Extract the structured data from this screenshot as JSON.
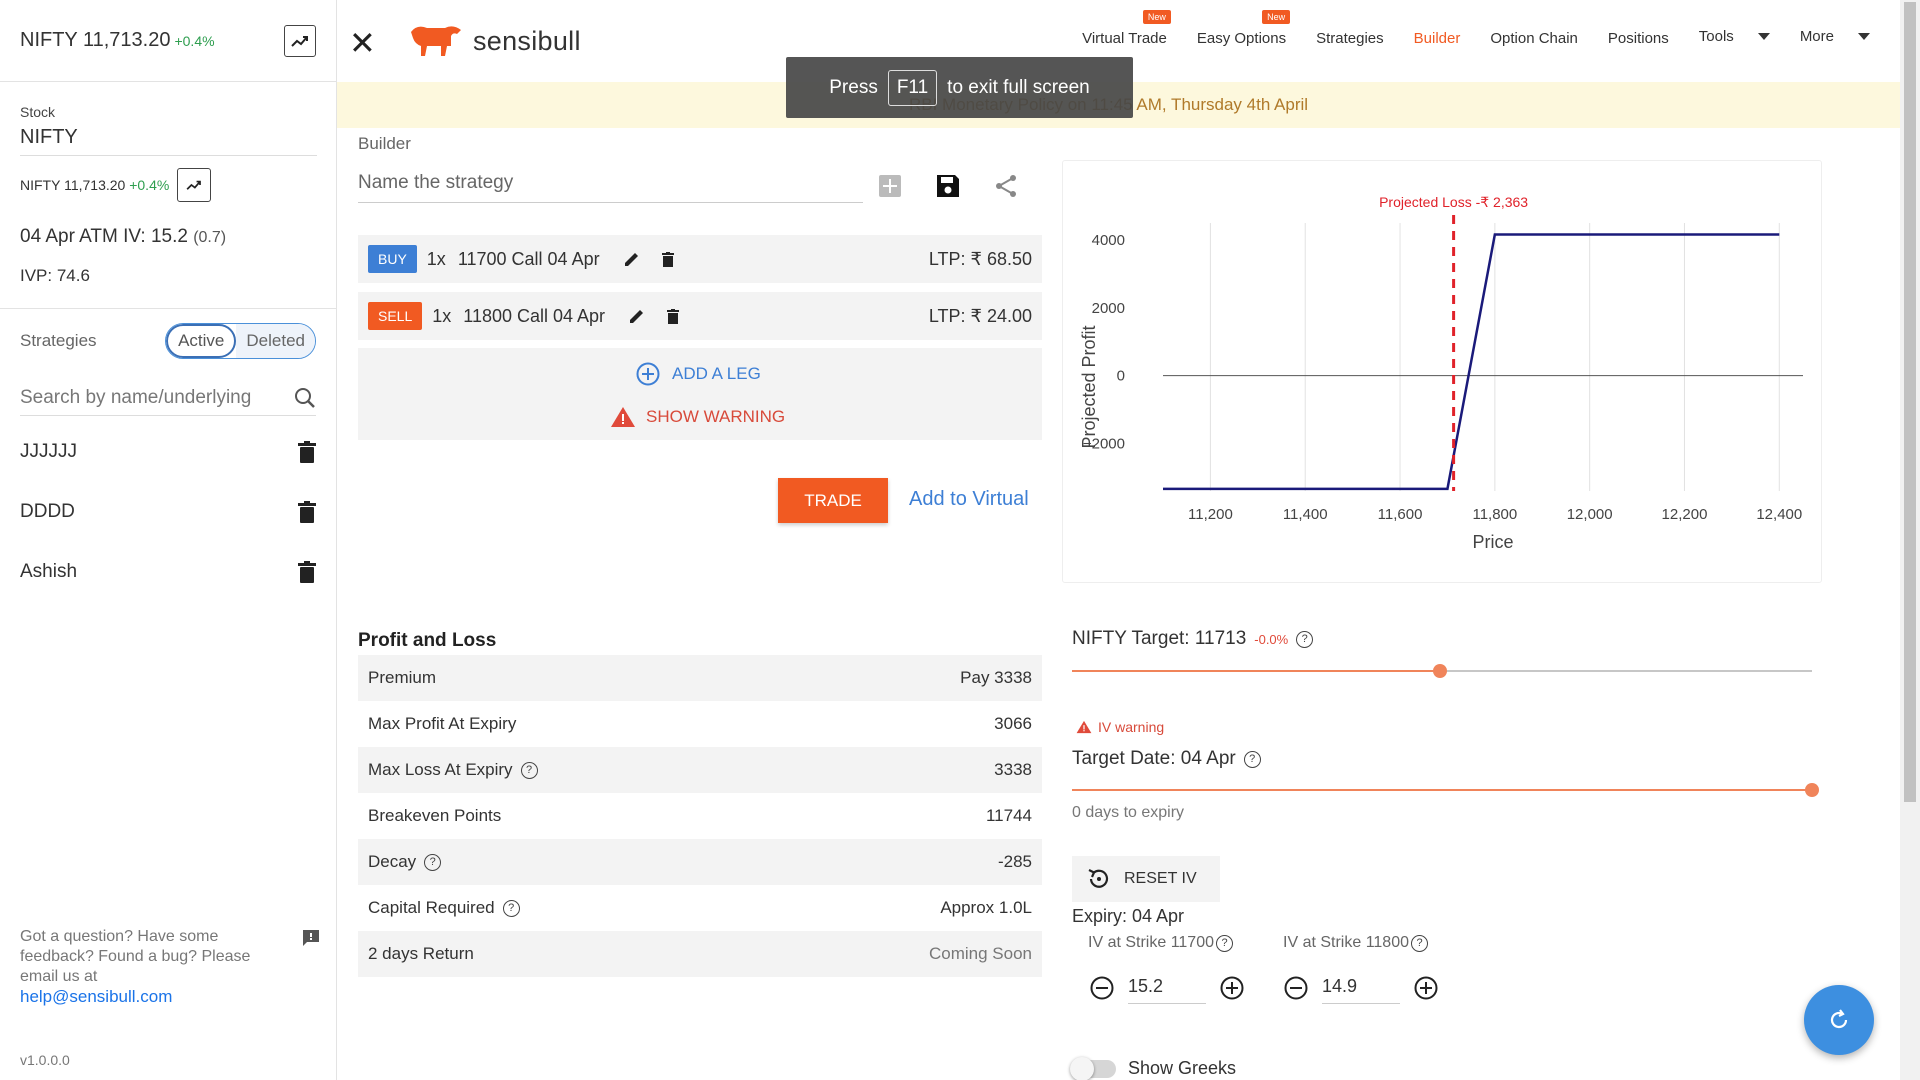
{
  "sidebar": {
    "ticker": "NIFTY 11,713.20",
    "ticker_change": "+0.4%",
    "stock_label": "Stock",
    "stock_value": "NIFTY",
    "ticker_small": "NIFTY 11,713.20",
    "ticker_small_change": "+0.4%",
    "atm_iv": "04 Apr ATM IV: 15.2",
    "atm_iv_change": "(0.7)",
    "ivp": "IVP: 74.6",
    "strategies_label": "Strategies",
    "toggle_active": "Active",
    "toggle_deleted": "Deleted",
    "search_placeholder": "Search by name/underlying",
    "saved": [
      "JJJJJJ",
      "DDDD",
      "Ashish"
    ],
    "feedback_text": "Got a question? Have some feedback? Found a bug? Please email us at",
    "feedback_email": "help@sensibull.com",
    "version": "v1.0.0.0"
  },
  "header": {
    "logo_text": "sensibull",
    "nav": [
      {
        "label": "Virtual Trade",
        "badge": "New"
      },
      {
        "label": "Easy Options",
        "badge": "New"
      },
      {
        "label": "Strategies"
      },
      {
        "label": "Builder",
        "active": true
      },
      {
        "label": "Option Chain"
      },
      {
        "label": "Positions"
      },
      {
        "label": "Tools"
      },
      {
        "label": "More"
      }
    ],
    "brand_color": "#f15a22"
  },
  "banner": {
    "text": "RBI Monetary Policy on 11:45 AM, Thursday 4th April"
  },
  "overlay": {
    "press": "Press",
    "key": "F11",
    "rest": "to exit full screen"
  },
  "builder": {
    "label": "Builder",
    "name_placeholder": "Name the strategy",
    "legs": [
      {
        "side": "BUY",
        "qty": "1x",
        "contract": "11700 Call 04 Apr",
        "ltp": "LTP: ₹ 68.50"
      },
      {
        "side": "SELL",
        "qty": "1x",
        "contract": "11800 Call 04 Apr",
        "ltp": "LTP: ₹ 24.00"
      }
    ],
    "add_leg": "ADD A LEG",
    "show_warning": "SHOW WARNING",
    "trade": "TRADE",
    "add_virtual": "Add to Virtual"
  },
  "chart_data": {
    "type": "line",
    "title": "",
    "xlabel": "Price",
    "ylabel": "Projected Profit",
    "xlim": [
      11100,
      12450
    ],
    "ylim": [
      -3400,
      4500
    ],
    "xticks": [
      11200,
      11400,
      11600,
      11800,
      12000,
      12200,
      12400
    ],
    "xtick_labels": [
      "11,200",
      "11,400",
      "11,600",
      "11,800",
      "12,000",
      "12,200",
      "12,400"
    ],
    "yticks": [
      4000,
      2000,
      0,
      -2000
    ],
    "ytick_labels": [
      "4000",
      "2000",
      "0",
      "−2000"
    ],
    "series": [
      {
        "x": [
          11100,
          11700,
          11800,
          12400
        ],
        "y": [
          -3338,
          -3338,
          4162,
          4162
        ],
        "color": "#1a1a7a"
      }
    ],
    "marker": {
      "x": 11713,
      "label": "Projected Loss -₹ 2,363",
      "color": "#e0222a"
    },
    "grid": true
  },
  "pnl": {
    "title": "Profit and Loss",
    "rows": [
      {
        "label": "Premium",
        "value": "Pay 3338",
        "help": false
      },
      {
        "label": "Max Profit At Expiry",
        "value": "3066",
        "help": false
      },
      {
        "label": "Max Loss At Expiry",
        "value": "3338",
        "help": true
      },
      {
        "label": "Breakeven Points",
        "value": "11744",
        "help": false
      },
      {
        "label": "Decay",
        "value": "-285",
        "help": true
      },
      {
        "label": "Capital Required",
        "value": "Approx 1.0L",
        "help": true
      },
      {
        "label": "2 days Return",
        "value": "Coming Soon",
        "help": false,
        "muted": true
      }
    ]
  },
  "controls": {
    "target_label": "NIFTY Target: 11713",
    "target_change": "-0.0%",
    "target_slider_fraction": 0.497,
    "iv_warning": "IV warning",
    "target_date": "Target Date: 04 Apr",
    "date_slider_fraction": 1.0,
    "days_to_expiry": "0 days to expiry",
    "reset_iv": "RESET IV",
    "expiry": "Expiry: 04 Apr",
    "iv_strikes": [
      {
        "label": "IV at Strike 11700",
        "value": "15.2"
      },
      {
        "label": "IV at Strike 11800",
        "value": "14.9"
      }
    ],
    "show_greeks": "Show Greeks"
  }
}
